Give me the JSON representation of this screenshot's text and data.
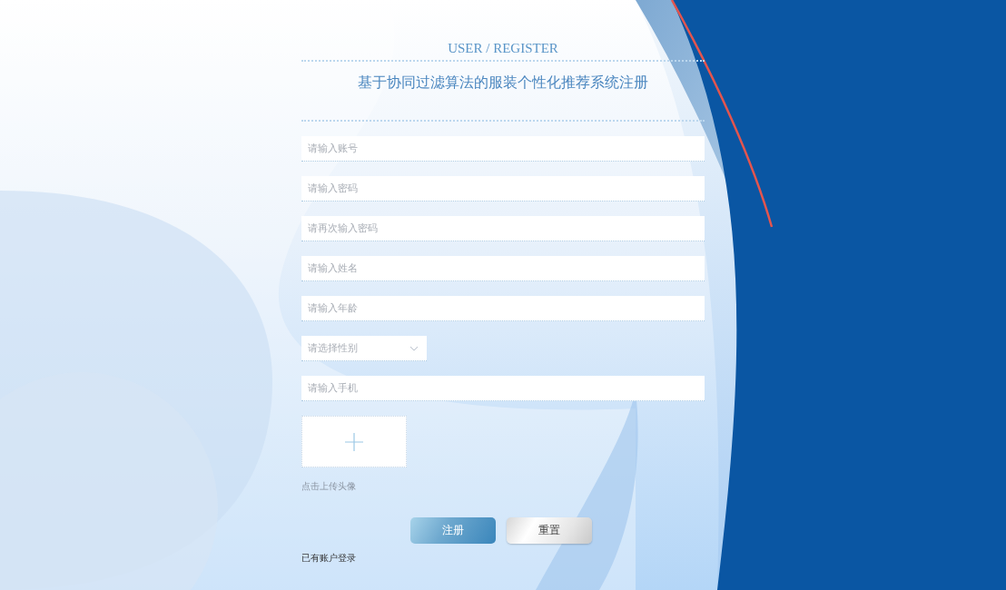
{
  "header": {
    "subtitle": "USER / REGISTER",
    "title": "基于协同过滤算法的服装个性化推荐系统注册"
  },
  "fields": [
    {
      "kind": "text",
      "placeholder": "请输入账号"
    },
    {
      "kind": "text",
      "placeholder": "请输入密码"
    },
    {
      "kind": "text",
      "placeholder": "请再次输入密码"
    },
    {
      "kind": "text",
      "placeholder": "请输入姓名"
    },
    {
      "kind": "text",
      "placeholder": "请输入年龄"
    },
    {
      "kind": "select",
      "placeholder": "请选择性别"
    },
    {
      "kind": "text",
      "placeholder": "请输入手机"
    }
  ],
  "upload": {
    "hint": "点击上传头像"
  },
  "buttons": [
    {
      "kind": "primary",
      "label": "注册"
    },
    {
      "kind": "secondary",
      "label": "重置"
    }
  ],
  "login_link": "已有账户登录"
}
